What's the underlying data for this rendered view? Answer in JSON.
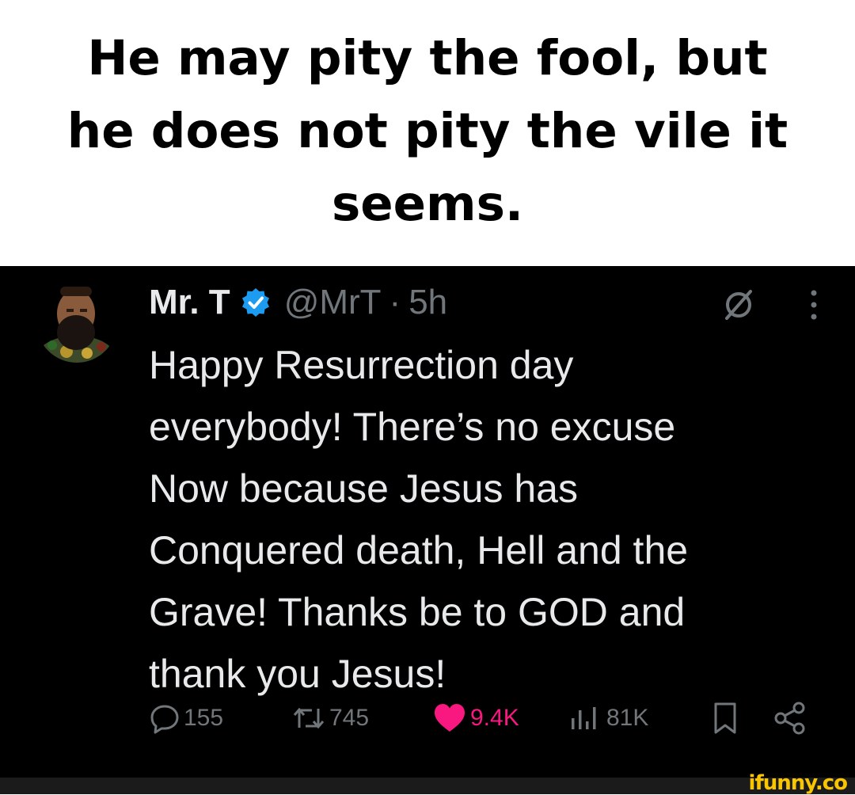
{
  "caption": "He may pity the fool, but\nhe does not pity the vile it\nseems.",
  "tweet": {
    "author": "Mr. T",
    "handle": "@MrT",
    "separator": "·",
    "time": "5h",
    "text": "Happy Resurrection day\neverybody! There’s no excuse\nNow because Jesus has\nConquered death, Hell and the\nGrave! Thanks be to GOD and\nthank you Jesus!",
    "stats": {
      "replies": "155",
      "reposts": "745",
      "likes": "9.4K",
      "views": "81K"
    }
  },
  "watermark": "ifunny.co",
  "colors": {
    "verified": "#1d9bf0",
    "like": "#f91880",
    "muted": "#71767b",
    "text": "#e7e9ea"
  },
  "icons": [
    "verified-badge-icon",
    "grok-icon",
    "more-icon",
    "reply-icon",
    "repost-icon",
    "like-icon",
    "views-icon",
    "bookmark-icon",
    "share-icon"
  ]
}
